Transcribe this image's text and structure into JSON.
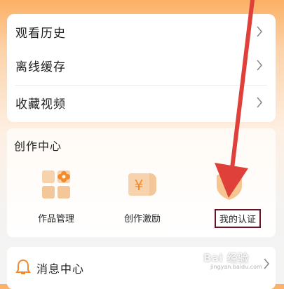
{
  "menu": {
    "items": [
      {
        "label": "观看历史"
      },
      {
        "label": "离线缓存"
      },
      {
        "label": "收藏视频"
      }
    ]
  },
  "creation_center": {
    "title": "创作中心",
    "tools": [
      {
        "label": "作品管理",
        "icon": "grid-flower-icon"
      },
      {
        "label": "创作激励",
        "icon": "yen-coin-icon"
      },
      {
        "label": "我的认证",
        "icon": "shield-badge-icon"
      }
    ]
  },
  "message_center": {
    "label": "消息中心",
    "icon": "bell-icon"
  },
  "watermark": {
    "text": "Bai 经验",
    "sub": "jingyan.baidu.com"
  },
  "colors": {
    "accent": "#f39b4b",
    "arrow": "#e0403a",
    "highlight_border": "#6b1424"
  }
}
